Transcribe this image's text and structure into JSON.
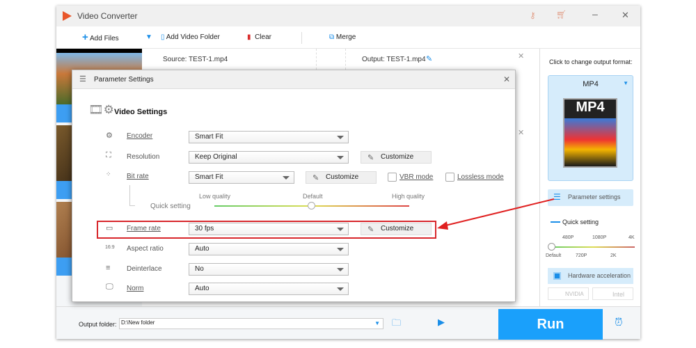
{
  "app": {
    "title": "Video Converter"
  },
  "toolbar": {
    "add_files": "Add Files",
    "add_video_folder": "Add Video Folder",
    "clear": "Clear",
    "merge": "Merge"
  },
  "file": {
    "source": "Source: TEST-1.mp4",
    "output": "Output: TEST-1.mp4"
  },
  "dialog": {
    "title": "Parameter Settings",
    "section": "Video Settings",
    "encoder": {
      "label": "Encoder",
      "value": "Smart Fit"
    },
    "resolution": {
      "label": "Resolution",
      "value": "Keep Original",
      "button": "Customize"
    },
    "bitrate": {
      "label": "Bit rate",
      "value": "Smart Fit",
      "button": "Customize",
      "vbr": "VBR mode",
      "lossless": "Lossless mode"
    },
    "quick": {
      "label": "Quick setting",
      "low": "Low quality",
      "default": "Default",
      "high": "High quality",
      "level": 0.5
    },
    "framerate": {
      "label": "Frame rate",
      "value": "30 fps",
      "button": "Customize"
    },
    "aspect": {
      "label": "Aspect ratio",
      "value": "Auto",
      "icon_text": "16:9"
    },
    "deinterlace": {
      "label": "Deinterlace",
      "value": "No"
    },
    "norm": {
      "label": "Norm",
      "value": "Auto"
    }
  },
  "right": {
    "hint": "Click to change output format:",
    "format": "MP4",
    "format_icon_text": "MP4",
    "param_settings": "Parameter settings",
    "quick_setting": "Quick setting",
    "ticks_top": [
      "480P",
      "1080P",
      "4K"
    ],
    "ticks_bottom": [
      "Default",
      "720P",
      "2K"
    ],
    "hw_accel": "Hardware acceleration",
    "nvidia": "NVIDIA",
    "intel": "Intel"
  },
  "bottom": {
    "output_label": "Output folder:",
    "output_value": "D:\\New folder",
    "run": "Run"
  },
  "colors": {
    "accent": "#1a9cf5",
    "highlight": "#e02020",
    "panel": "#d6ecfb"
  }
}
